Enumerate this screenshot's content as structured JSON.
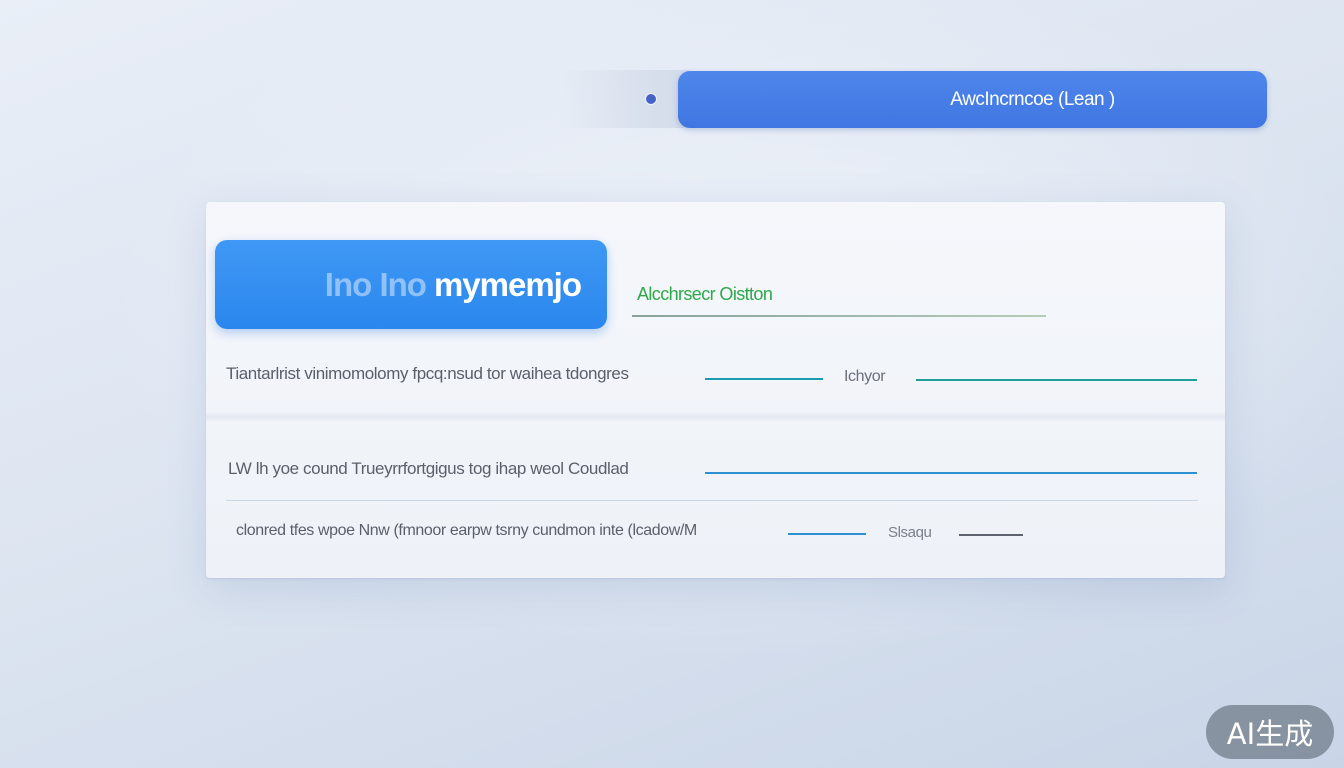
{
  "header": {
    "primary_button_label": "AwcIncrncoe (Lean )"
  },
  "card": {
    "brand_button": {
      "ghost_text": "Ino Ino",
      "label": "mymemjo"
    },
    "tab_label": "Alcchrsecr Oistton",
    "rows": [
      {
        "text": "Tiantarlrist vinimomolomy fpcq:nsud tor  waihea  tdongres",
        "side_label": "Ichyor"
      },
      {
        "text": "LW lh yoe cound  Trueyrrfortgigus  tog  ihap  weol  Coudlad"
      },
      {
        "text": "clonred tfes  wpoe  Nnw (fmnoor  earpw  tsrny  cundmon inte  (lcadow/M",
        "side_label": "Slsaqu"
      }
    ]
  },
  "watermark": "AI生成",
  "colors": {
    "accent_blue": "#3f76e2",
    "brand_blue": "#2b87ee",
    "tab_green": "#2fa84a",
    "line_teal": "#1a9bb4",
    "line_blue": "#2b8fd0"
  }
}
